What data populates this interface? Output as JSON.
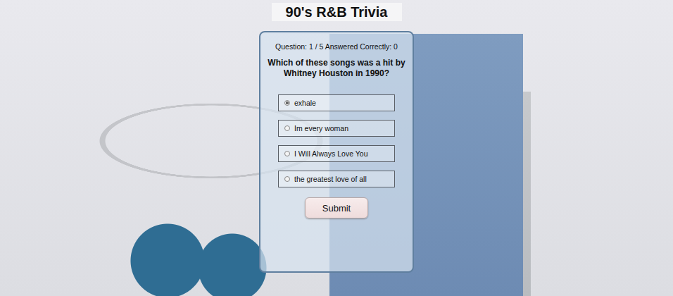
{
  "title": "90's R&B Trivia",
  "status": "Question: 1 / 5 Answered Correctly: 0",
  "question": "Which of these songs was a hit by Whitney Houston in 1990?",
  "options": [
    {
      "label": "exhale",
      "selected": true
    },
    {
      "label": "Im every woman",
      "selected": false
    },
    {
      "label": "I Will Always Love You",
      "selected": false
    },
    {
      "label": "the greatest love of all",
      "selected": false
    }
  ],
  "submit": "Submit"
}
